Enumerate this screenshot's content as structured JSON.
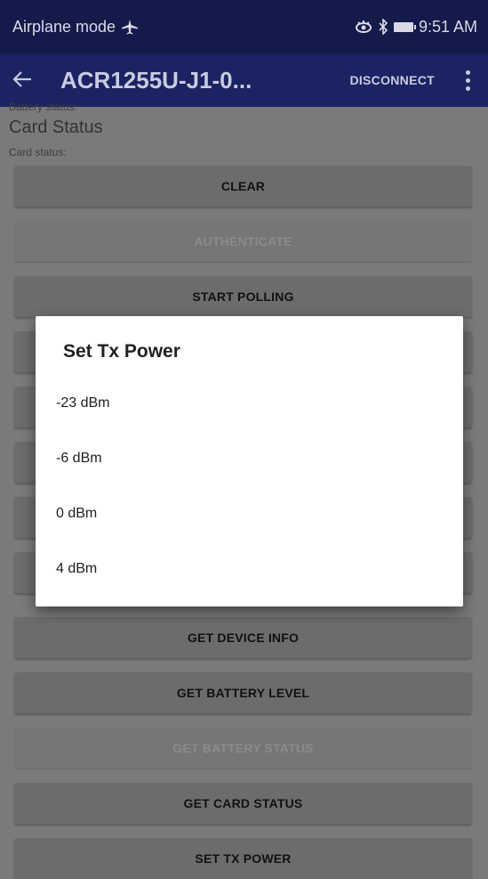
{
  "status_bar": {
    "left_text": "Airplane mode",
    "time": "9:51 AM"
  },
  "app_bar": {
    "back_icon": "arrow-left",
    "title": "ACR1255U-J1-0...",
    "disconnect_label": "DISCONNECT",
    "overflow_icon": "more-vert"
  },
  "background": {
    "battery_status_label": "Battery status:",
    "card_status_title": "Card Status",
    "card_status_label": "Card status:",
    "buttons": [
      {
        "label": "CLEAR",
        "enabled": true
      },
      {
        "label": "AUTHENTICATE",
        "enabled": false
      },
      {
        "label": "START POLLING",
        "enabled": true
      },
      {
        "label": "",
        "enabled": true
      },
      {
        "label": "",
        "enabled": true
      },
      {
        "label": "",
        "enabled": true
      },
      {
        "label": "",
        "enabled": true
      },
      {
        "label": "",
        "enabled": true
      },
      {
        "label": "GET DEVICE INFO",
        "enabled": true
      },
      {
        "label": "GET BATTERY LEVEL",
        "enabled": true
      },
      {
        "label": "GET BATTERY STATUS",
        "enabled": false
      },
      {
        "label": "GET CARD STATUS",
        "enabled": true
      },
      {
        "label": "SET TX POWER",
        "enabled": true
      }
    ]
  },
  "dialog": {
    "title": "Set Tx Power",
    "options": [
      "-23 dBm",
      "-6 dBm",
      "0 dBm",
      "4 dBm"
    ]
  }
}
